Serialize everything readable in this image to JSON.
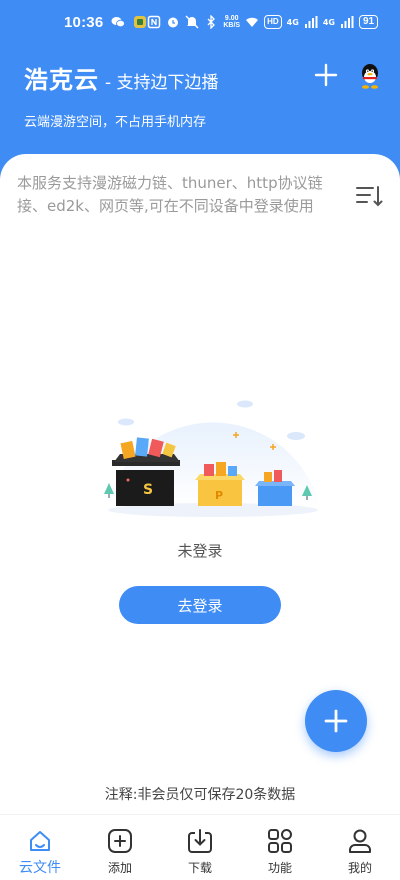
{
  "status_bar": {
    "time": "10:36",
    "net_speed_top": "9.00",
    "net_speed_bottom": "KB/S",
    "hd_label": "HD",
    "signal_1": "4G",
    "signal_2": "4G",
    "battery": "91"
  },
  "header": {
    "app_name": "浩克云",
    "slogan": "- 支持边下边播",
    "subtitle": "云端漫游空间，不占用手机内存"
  },
  "main": {
    "notice": "本服务支持漫游磁力链、thuner、http协议链接、ed2k、网页等,可在不同设备中登录使用",
    "empty_label": "未登录",
    "login_button": "去登录",
    "footnote": "注释:非会员仅可保存20条数据"
  },
  "nav": {
    "items": [
      {
        "label": "云文件",
        "icon": "cloud-home-icon",
        "active": true
      },
      {
        "label": "添加",
        "icon": "add-square-icon",
        "active": false
      },
      {
        "label": "下载",
        "icon": "download-icon",
        "active": false
      },
      {
        "label": "功能",
        "icon": "grid-icon",
        "active": false
      },
      {
        "label": "我的",
        "icon": "user-icon",
        "active": false
      }
    ]
  },
  "colors": {
    "brand": "#3f8cf5",
    "text_gray": "#9a9a9a"
  }
}
